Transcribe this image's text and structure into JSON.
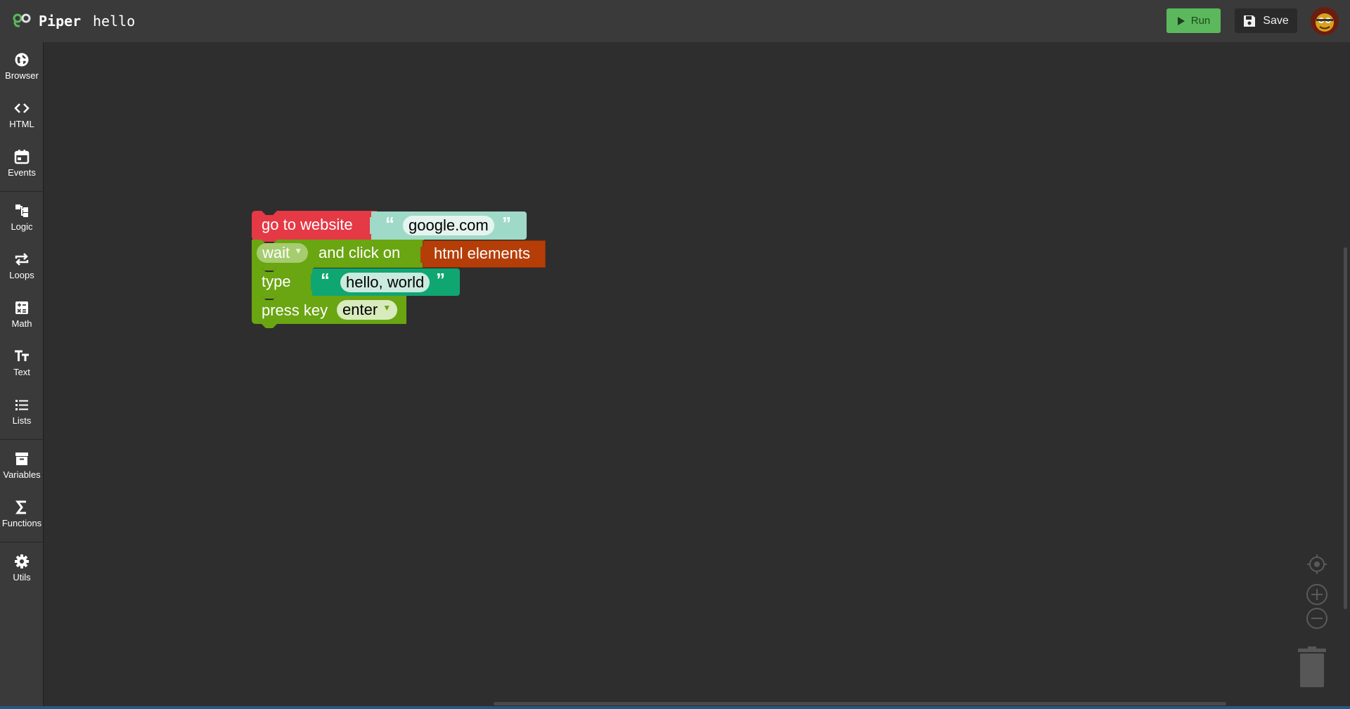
{
  "app": {
    "name": "Piper",
    "project": "hello"
  },
  "toolbar": {
    "run_label": "Run",
    "save_label": "Save"
  },
  "sidebar": {
    "items": [
      {
        "label": "Browser",
        "icon": "globe-icon"
      },
      {
        "label": "HTML",
        "icon": "code-icon"
      },
      {
        "label": "Events",
        "icon": "calendar-icon"
      },
      {
        "label": "Logic",
        "icon": "logic-icon"
      },
      {
        "label": "Loops",
        "icon": "loop-icon"
      },
      {
        "label": "Math",
        "icon": "calculator-icon"
      },
      {
        "label": "Text",
        "icon": "text-icon"
      },
      {
        "label": "Lists",
        "icon": "list-icon"
      },
      {
        "label": "Variables",
        "icon": "archive-icon"
      },
      {
        "label": "Functions",
        "icon": "sigma-icon"
      },
      {
        "label": "Utils",
        "icon": "gear-icon"
      }
    ]
  },
  "blocks": {
    "goto": {
      "label": "go to website",
      "url": "google.com",
      "color": "#e53946"
    },
    "click": {
      "mode": "wait",
      "label": "and click on",
      "target": "html elements",
      "color": "#6aa512",
      "target_color": "#b53e08"
    },
    "type": {
      "label": "type",
      "text": "hello, world",
      "color": "#6aa512",
      "text_color": "#0fa672"
    },
    "press": {
      "label": "press key",
      "key": "enter",
      "color": "#6aa512"
    }
  },
  "colors": {
    "run": "#5cb85c",
    "workspace": "#2e2e2e",
    "topbar": "#3a3a3a"
  }
}
